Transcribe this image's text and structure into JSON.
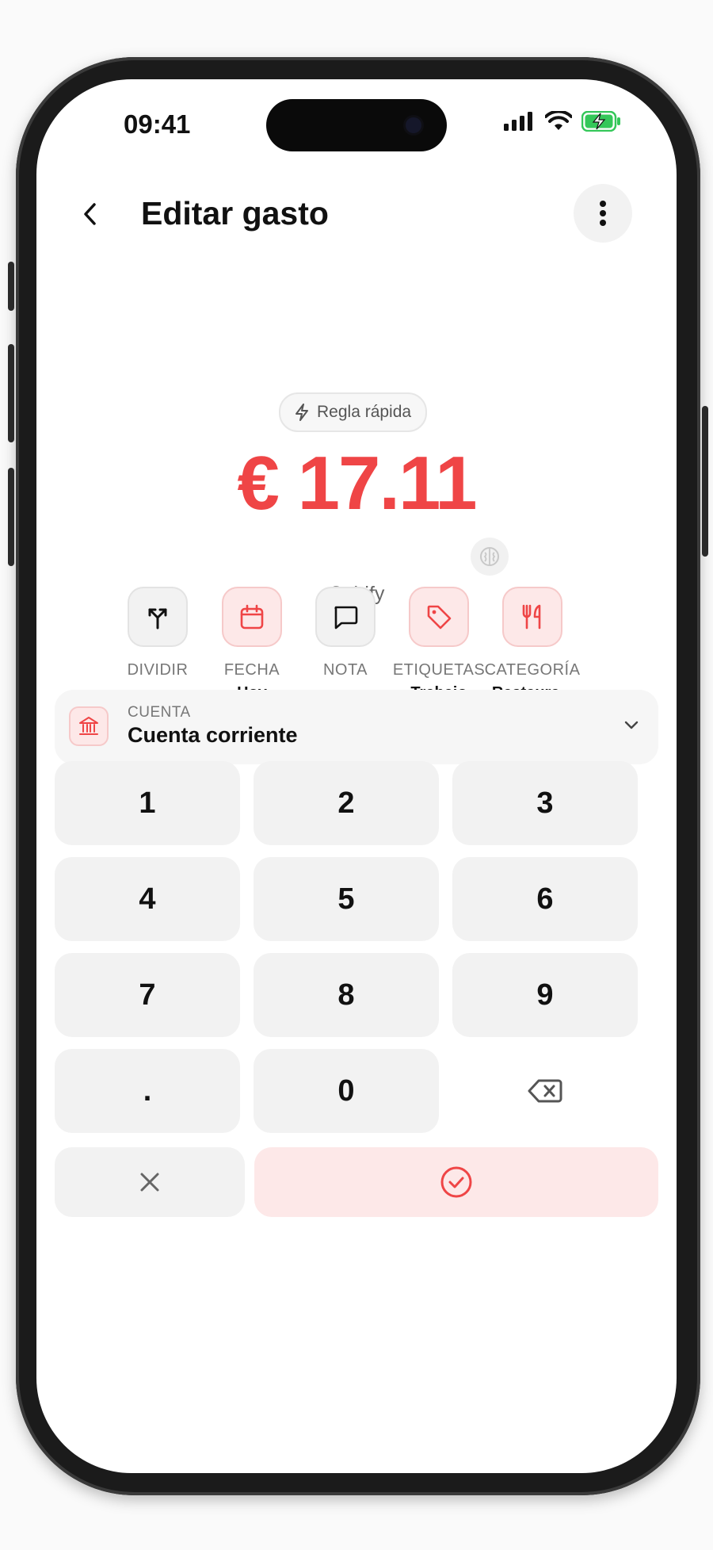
{
  "status_bar": {
    "time": "09:41",
    "icons": [
      "signal-icon",
      "wifi-icon",
      "battery-charging-icon"
    ]
  },
  "header": {
    "back_icon": "chevron-left-icon",
    "title": "Editar gasto",
    "menu_icon": "more-vertical-icon"
  },
  "rule_chip": {
    "icon": "bolt-icon",
    "label": "Regla rápida"
  },
  "amount": {
    "display": "€ 17.11",
    "color": "#ef4546"
  },
  "merchant": "Cabify",
  "ai_icon": "brain-icon",
  "actions": [
    {
      "id": "dividir",
      "icon": "split-icon",
      "label": "DIVIDIR",
      "value": ""
    },
    {
      "id": "fecha",
      "icon": "calendar-icon",
      "label": "FECHA",
      "value": "Hoy"
    },
    {
      "id": "nota",
      "icon": "message-square-icon",
      "label": "NOTA",
      "value": ""
    },
    {
      "id": "etiquetas",
      "icon": "tag-icon",
      "label": "ETIQUETAS",
      "value": "Trabajo"
    },
    {
      "id": "categoria",
      "icon": "utensils-icon",
      "label": "CATEGORÍA",
      "value": "Restaura..."
    }
  ],
  "account": {
    "icon": "bank-icon",
    "label": "CUENTA",
    "value": "Cuenta corriente"
  },
  "keypad": {
    "keys": [
      "1",
      "2",
      "3",
      "4",
      "5",
      "6",
      "7",
      "8",
      "9",
      ".",
      "0"
    ],
    "backspace_icon": "backspace-icon",
    "cancel_icon": "close-icon",
    "confirm_icon": "check-circle-icon"
  },
  "colors": {
    "accent": "#ef4546",
    "accent_soft": "#fde8e8",
    "key_bg": "#f2f2f2"
  }
}
